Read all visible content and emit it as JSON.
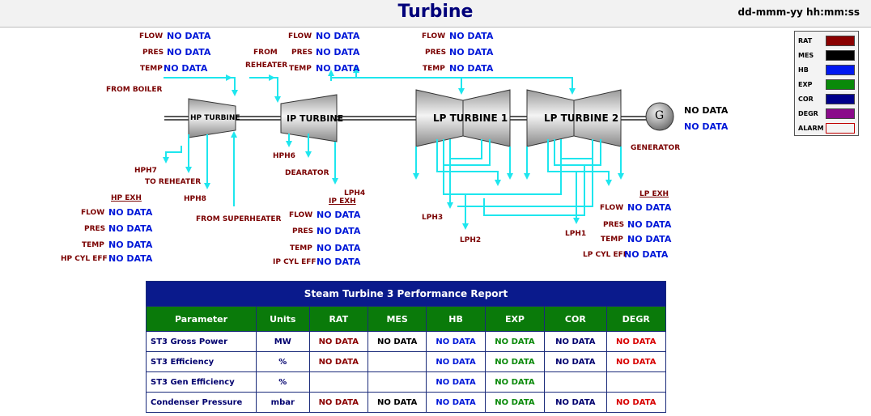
{
  "header": {
    "title": "Turbine",
    "datetime": "dd-mmm-yy hh:mm:ss"
  },
  "no_data": "NO DATA",
  "labels": {
    "flow": "FLOW",
    "pres": "PRES",
    "temp": "TEMP",
    "hp_cyl_eff": "HP CYL EFF",
    "ip_cyl_eff": "IP CYL EFF",
    "lp_cyl_eff": "LP CYL EFF",
    "hp_exh": "HP EXH",
    "ip_exh": "IP EXH",
    "lp_exh": "LP EXH",
    "from_boiler": "FROM BOILER",
    "from_reheater_1": "FROM",
    "from_reheater_2": "REHEATER",
    "hph7": "HPH7",
    "to_reheater": "TO REHEATER",
    "hph8": "HPH8",
    "from_superheater": "FROM SUPERHEATER",
    "hph6": "HPH6",
    "dearator": "DEARATOR",
    "lph4": "LPH4",
    "lph3": "LPH3",
    "lph2": "LPH2",
    "lph1": "LPH1",
    "generator": "GENERATOR"
  },
  "turbines": {
    "hp": "HP TURBINE",
    "ip": "IP TURBINE",
    "lp1": "LP TURBINE 1",
    "lp2": "LP TURBINE 2",
    "gen": "G"
  },
  "legend": {
    "items": [
      {
        "label": "RAT",
        "color": "#8a0000"
      },
      {
        "label": "MES",
        "color": "#000000"
      },
      {
        "label": "HB",
        "color": "#0018f0"
      },
      {
        "label": "EXP",
        "color": "#0a8a0a"
      },
      {
        "label": "COR",
        "color": "#00008a"
      },
      {
        "label": "DEGR",
        "color": "#8a0a8a"
      },
      {
        "label": "ALARM",
        "color": "#f4f4f4"
      }
    ]
  },
  "report": {
    "title": "Steam Turbine 3 Performance Report",
    "columns": [
      "Parameter",
      "Units",
      "RAT",
      "MES",
      "HB",
      "EXP",
      "COR",
      "DEGR"
    ],
    "rows": [
      {
        "param": "ST3 Gross Power",
        "units": "MW",
        "rat": "NO DATA",
        "mes": "NO DATA",
        "hb": "NO DATA",
        "exp": "NO DATA",
        "cor": "NO DATA",
        "degr": "NO DATA"
      },
      {
        "param": "ST3 Efficiency",
        "units": "%",
        "rat": "NO DATA",
        "mes": "",
        "hb": "NO DATA",
        "exp": "NO DATA",
        "cor": "NO DATA",
        "degr": "NO DATA"
      },
      {
        "param": "ST3 Gen Efficiency",
        "units": "%",
        "rat": "",
        "mes": "",
        "hb": "NO DATA",
        "exp": "NO DATA",
        "cor": "",
        "degr": ""
      },
      {
        "param": "Condenser Pressure",
        "units": "mbar",
        "rat": "NO DATA",
        "mes": "NO DATA",
        "hb": "NO DATA",
        "exp": "NO DATA",
        "cor": "NO DATA",
        "degr": "NO DATA"
      }
    ]
  }
}
